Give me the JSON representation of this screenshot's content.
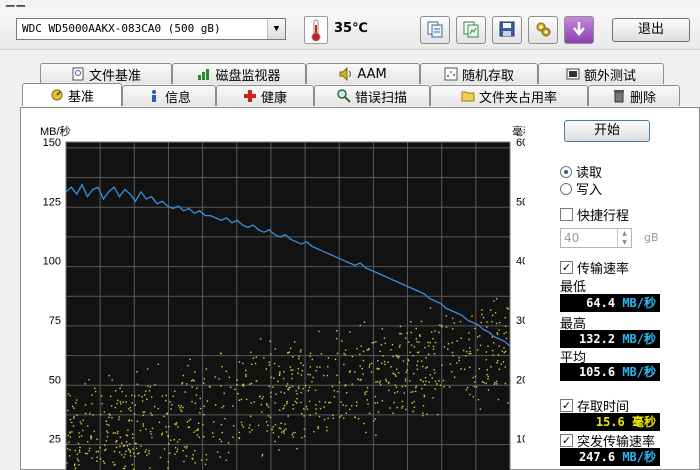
{
  "toolbar": {
    "drive": "WDC WD5000AAKX-083CA0 (500 gB)",
    "temperature": "35℃",
    "exit_label": "退出",
    "icons": [
      "copy-text-icon",
      "copy-chart-icon",
      "save-icon",
      "options-icon",
      "download-icon"
    ]
  },
  "tabs_top": [
    {
      "label": "文件基准",
      "icon": "file-benchmark-icon"
    },
    {
      "label": "磁盘监视器",
      "icon": "disk-monitor-icon"
    },
    {
      "label": "AAM",
      "icon": "speaker-icon"
    },
    {
      "label": "随机存取",
      "icon": "random-access-icon"
    },
    {
      "label": "额外测试",
      "icon": "extra-tests-icon"
    }
  ],
  "tabs_bottom": [
    {
      "label": "基准",
      "icon": "benchmark-icon",
      "active": true
    },
    {
      "label": "信息",
      "icon": "info-icon"
    },
    {
      "label": "健康",
      "icon": "health-cross-icon"
    },
    {
      "label": "错误扫描",
      "icon": "magnifier-icon"
    },
    {
      "label": "文件夹占用率",
      "icon": "folder-icon"
    },
    {
      "label": "删除",
      "icon": "trash-icon"
    }
  ],
  "sidebar": {
    "start_label": "开始",
    "read_label": "读取",
    "write_label": "写入",
    "read_selected": true,
    "short_stroke_label": "快捷行程",
    "short_stroke_checked": false,
    "short_stroke_value": "40",
    "short_stroke_unit": "gB",
    "transfer_rate_label": "传输速率",
    "transfer_rate_checked": true,
    "min_label": "最低",
    "min_value": "64.4",
    "max_label": "最高",
    "max_value": "132.2",
    "avg_label": "平均",
    "avg_value": "105.6",
    "rate_unit": "MB/秒",
    "access_time_label": "存取时间",
    "access_time_checked": true,
    "access_time_value": "15.6",
    "access_time_unit": "毫秒",
    "burst_rate_label": "突发传输速率",
    "burst_rate_checked": true,
    "burst_rate_value": "247.6",
    "burst_rate_unit": "MB/秒"
  },
  "chart_data": {
    "type": "line",
    "ylabel_left": "MB/秒",
    "ylabel_right": "毫秒",
    "ylim_left": [
      0,
      150
    ],
    "ylim_right": [
      0,
      60
    ],
    "yticks_left": [
      150,
      125,
      100,
      75,
      50,
      25
    ],
    "yticks_right": [
      60,
      50,
      40,
      30,
      20,
      10
    ],
    "grid": true,
    "colors": {
      "background": "#121212",
      "grid": "#5a5a5a",
      "transfer": "#3a8fd8",
      "access": "#d4cf3c"
    },
    "series": [
      {
        "values": [
          129,
          131,
          128,
          132,
          127,
          130,
          131,
          126,
          129,
          131,
          127,
          130,
          128,
          125,
          129,
          126,
          127,
          124,
          125,
          123,
          122,
          123,
          121,
          122,
          120,
          121,
          119,
          119,
          118,
          117,
          118,
          116,
          117,
          115,
          114,
          115,
          113,
          112,
          113,
          111,
          110,
          111,
          109,
          108,
          107,
          108,
          106,
          105,
          104,
          103,
          102,
          101,
          100,
          99,
          98,
          99,
          97,
          96,
          95,
          94,
          93,
          92,
          91,
          90,
          89,
          88,
          87,
          86,
          84,
          83,
          82,
          80,
          79,
          78,
          77,
          75,
          74,
          73,
          71,
          70,
          68,
          67,
          66,
          64
        ]
      },
      {
        "values": [
          9.4,
          10.1,
          10.9,
          11.4,
          11.8,
          12.5,
          12.9,
          13.6,
          14.1,
          14.7,
          15.2,
          15.8,
          16.4,
          16.9,
          17.3,
          18.0,
          18.6,
          19.1,
          19.7,
          20.4,
          20.9,
          21.5,
          22.0,
          22.6,
          23.1,
          23.8,
          24.4,
          24.9,
          25.5
        ]
      }
    ]
  }
}
